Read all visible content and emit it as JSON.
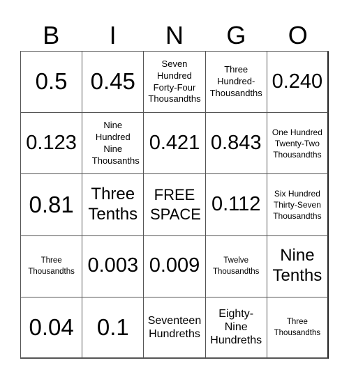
{
  "header": {
    "letters": [
      "B",
      "I",
      "N",
      "G",
      "O"
    ]
  },
  "board": {
    "rows": [
      [
        "0.5",
        "0.45",
        "Seven Hundred Forty-Four Thousandths",
        "Three Hundred-Thousandths",
        "0.240"
      ],
      [
        "0.123",
        "Nine Hundred Nine Thousanths",
        "0.421",
        "0.843",
        "One Hundred Twenty-Two Thousandths"
      ],
      [
        "0.81",
        "Three Tenths",
        "FREE SPACE",
        "0.112",
        "Six Hundred Thirty-Seven Thousandths"
      ],
      [
        "Three Thousandths",
        "0.003",
        "0.009",
        "Twelve Thousandths",
        "Nine Tenths"
      ],
      [
        "0.04",
        "0.1",
        "Seventeen Hundreths",
        "Eighty-Nine Hundreths",
        "Three Thousandths"
      ]
    ]
  }
}
